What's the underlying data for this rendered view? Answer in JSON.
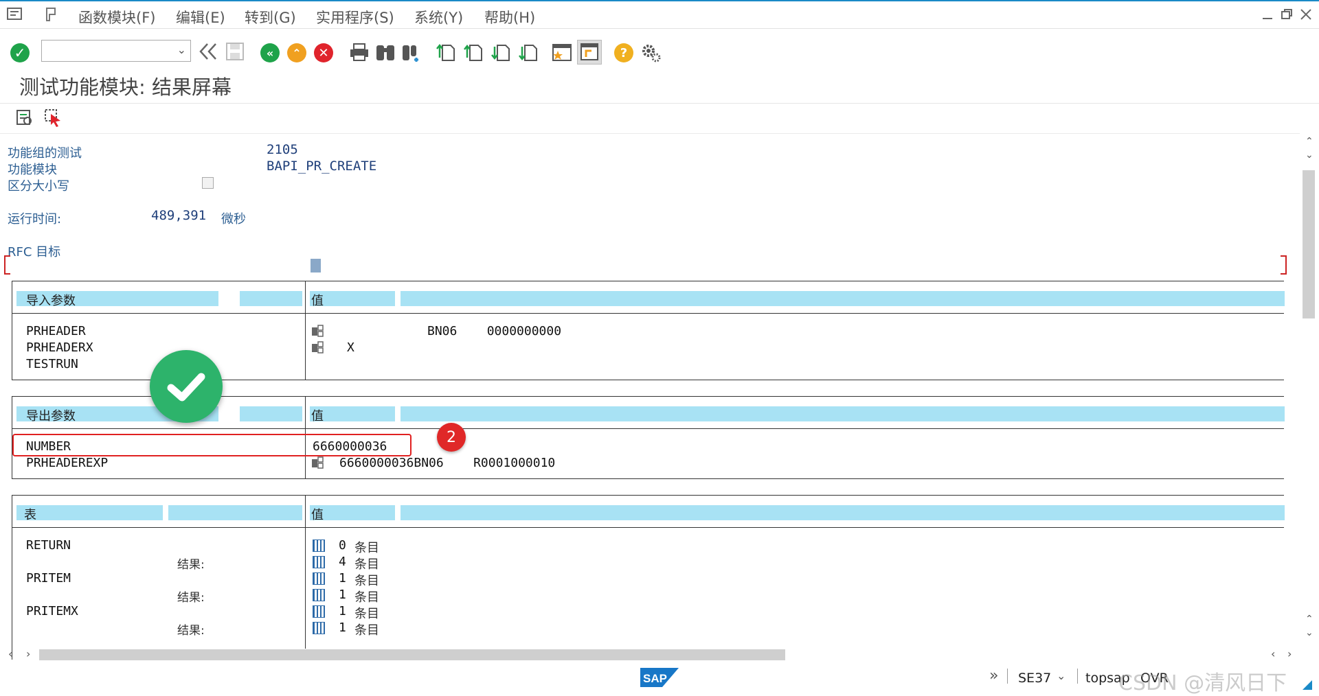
{
  "menu": {
    "items": [
      "函数模块(F)",
      "编辑(E)",
      "转到(G)",
      "实用程序(S)",
      "系统(Y)",
      "帮助(H)"
    ]
  },
  "toolbar": {
    "command_value": "",
    "icons": [
      "check-icon",
      "back-double-icon",
      "save-icon",
      "back-icon",
      "exit-icon",
      "cancel-icon",
      "print-icon",
      "find-icon",
      "find-next-icon",
      "first-page-icon",
      "prev-page-icon",
      "next-page-icon",
      "last-page-icon",
      "new-session-icon",
      "shortcut-icon",
      "help-icon",
      "settings-icon"
    ]
  },
  "page": {
    "title": "测试功能模块: 结果屏幕"
  },
  "info": {
    "group_label": "功能组的测试",
    "group_value": "2105",
    "module_label": "功能模块",
    "module_value": "BAPI_PR_CREATE",
    "case_label": "区分大小写",
    "runtime_label": "运行时间:",
    "runtime_value": "489,391",
    "runtime_unit": "微秒",
    "rfc_label": "RFC 目标"
  },
  "import": {
    "header": "导入参数",
    "value_header": "值",
    "params": [
      {
        "name": "PRHEADER",
        "value": "BN06    0000000000",
        "struct": true
      },
      {
        "name": "PRHEADERX",
        "value": "X",
        "struct": true
      },
      {
        "name": "TESTRUN",
        "value": "",
        "struct": false
      }
    ]
  },
  "export": {
    "header": "导出参数",
    "value_header": "值",
    "params": [
      {
        "name": "NUMBER",
        "value": "6660000036",
        "struct": false
      },
      {
        "name": "PRHEADEREXP",
        "value": "6660000036BN06    R0001000010",
        "struct": true
      }
    ]
  },
  "tables": {
    "header": "表",
    "value_header": "值",
    "result_label": "结果:",
    "entry_unit": "条目",
    "rows": [
      {
        "name": "RETURN",
        "before": "0",
        "after": "4"
      },
      {
        "name": "PRITEM",
        "before": "1",
        "after": "1"
      },
      {
        "name": "PRITEMX",
        "before": "1",
        "after": "1"
      }
    ]
  },
  "annotation": {
    "badge": "2"
  },
  "status": {
    "transaction": "SE37",
    "server": "topsap",
    "mode": "OVR",
    "watermark": "CSDN @清风日下"
  },
  "colors": {
    "accent": "#1a8ac7",
    "header_bar": "#a8e2f4",
    "highlight_red": "#e02020",
    "check_green": "#2db36b"
  }
}
